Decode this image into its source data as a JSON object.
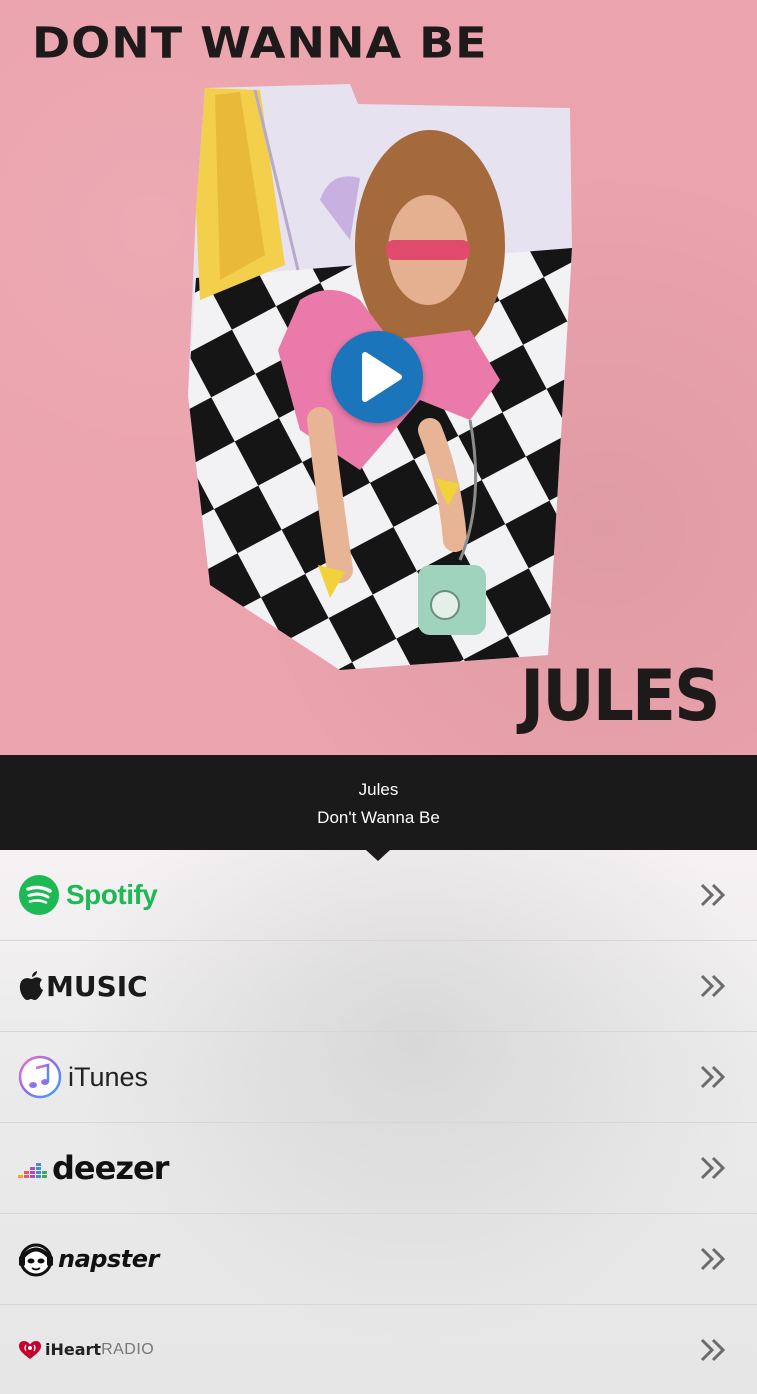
{
  "cover": {
    "title": "DONT WANNA BE",
    "artist_art": "JULES",
    "play_icon": "play-icon"
  },
  "info": {
    "artist": "Jules",
    "track": "Don't Wanna Be"
  },
  "services": [
    {
      "id": "spotify",
      "label": "Spotify",
      "icon": "spotify-icon",
      "color": "#1db954"
    },
    {
      "id": "apple-music",
      "label": "MUSIC",
      "icon": "apple-icon"
    },
    {
      "id": "itunes",
      "label": "iTunes",
      "icon": "itunes-icon"
    },
    {
      "id": "deezer",
      "label": "deezer",
      "icon": "deezer-icon"
    },
    {
      "id": "napster",
      "label": "napster",
      "icon": "napster-icon"
    },
    {
      "id": "iheartradio",
      "label_bold": "iHeart",
      "label_light": "RADIO",
      "icon": "iheart-icon",
      "color": "#c6002b"
    }
  ],
  "chevron_icon": "double-chevron-right-icon",
  "colors": {
    "cover_bg": "#eba3ad",
    "play_button": "#1b75bb",
    "info_bar_bg": "#1a1a1a"
  }
}
